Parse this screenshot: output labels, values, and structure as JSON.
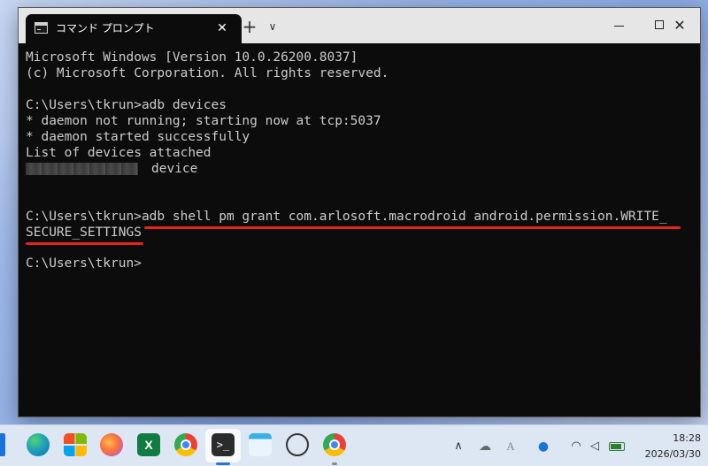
{
  "window": {
    "tab_title": "コマンド プロンプト",
    "close_tab_glyph": "✕",
    "new_tab_glyph": "+",
    "dropdown_glyph": "∨",
    "close_glyph": "✕"
  },
  "console": {
    "lines": [
      "Microsoft Windows [Version 10.0.26200.8037]",
      "(c) Microsoft Corporation. All rights reserved.",
      "C:\\Users\\tkrun>adb devices",
      "* daemon not running; starting now at tcp:5037",
      "* daemon started successfully",
      "List of devices attached",
      "device",
      "C:\\Users\\tkrun>adb shell pm grant com.arlosoft.macrodroid android.permission.WRITE_",
      "SECURE_SETTINGS",
      "C:\\Users\\tkrun>"
    ]
  },
  "colors": {
    "console_bg": "#0c0c0c",
    "console_text": "#cccccc",
    "highlight_underline": "#e8231a",
    "titlebar": "#e6e6e6",
    "taskbar": "#dde6f3"
  },
  "taskbar": {
    "apps": [
      "start",
      "edge-icon",
      "microsoft-store-icon",
      "firefox-icon",
      "excel-icon",
      "chrome-icon",
      "terminal-icon",
      "notepad-icon",
      "chatgpt-icon",
      "chrome-profile-icon"
    ],
    "excel_glyph": "X",
    "terminal_glyph": ">_",
    "tray": {
      "chevron": "∧",
      "cloud": "☁",
      "ime": "A",
      "status": "●",
      "wifi": "◠",
      "volume": "◁"
    },
    "clock": {
      "time": "18:28",
      "date": "2026/03/30"
    }
  }
}
